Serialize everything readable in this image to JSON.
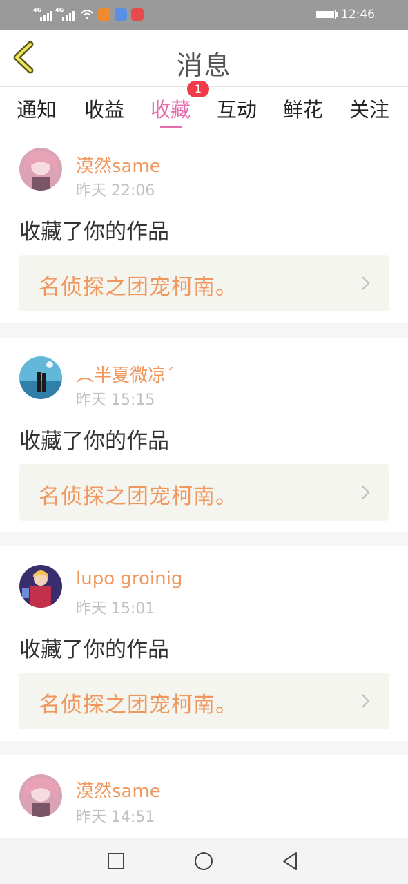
{
  "status_bar": {
    "time": "12:46",
    "signal1": "4G",
    "signal2": "4G"
  },
  "header": {
    "title": "消息"
  },
  "tabs": [
    {
      "label": "通知"
    },
    {
      "label": "收益"
    },
    {
      "label": "收藏",
      "active": true,
      "badge": "1"
    },
    {
      "label": "互动"
    },
    {
      "label": "鲜花"
    },
    {
      "label": "关注"
    }
  ],
  "notifications": [
    {
      "username": "漠然same",
      "time": "昨天 22:06",
      "action": "收藏了你的作品",
      "work": "名侦探之团宠柯南。"
    },
    {
      "username": "︵半夏微凉ˊ",
      "time": "昨天 15:15",
      "action": "收藏了你的作品",
      "work": "名侦探之团宠柯南。"
    },
    {
      "username": "lupo groinig",
      "time": "昨天 15:01",
      "action": "收藏了你的作品",
      "work": "名侦探之团宠柯南。"
    },
    {
      "username": "漠然same",
      "time": "昨天 14:51"
    }
  ],
  "colors": {
    "accent": "#e56faa",
    "username": "#f0975e",
    "badge": "#f03a4a"
  }
}
